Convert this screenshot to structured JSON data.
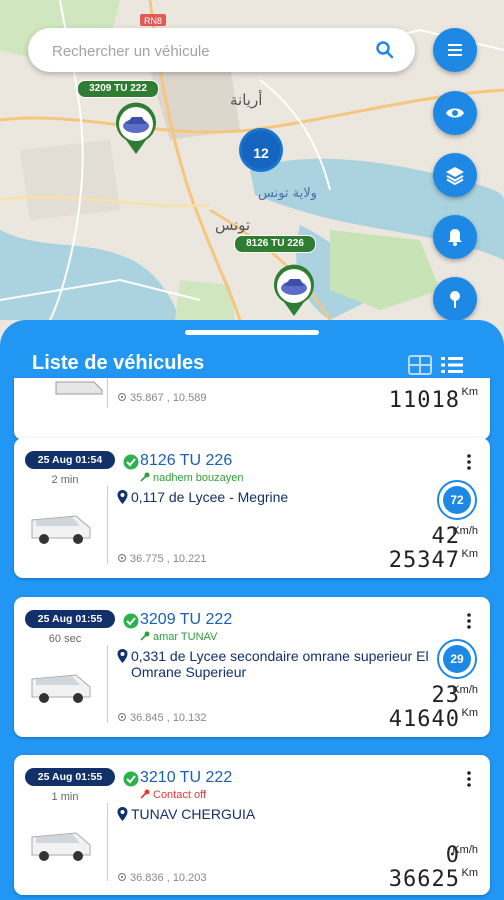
{
  "search": {
    "placeholder": "Rechercher un véhicule"
  },
  "map": {
    "labels": {
      "ariana": "أريانة",
      "tunis": "تونس",
      "wilayat": "ولاية تونس",
      "cluster_count": "12",
      "road": "RN8"
    },
    "markers": [
      {
        "plate": "3209 TU 222"
      },
      {
        "plate": "8126 TU 226"
      }
    ]
  },
  "fabs": [
    "menu-icon",
    "eye-icon",
    "layers-icon",
    "bell-icon",
    "pin-icon"
  ],
  "panel": {
    "title": "Liste de véhicules"
  },
  "vehicles_partial": {
    "coords": "35.867 , 10.589",
    "odometer": "11018",
    "odometer_unit": "Km"
  },
  "vehicles": [
    {
      "date": "25 Aug 01:54",
      "ago": "2 min",
      "plate": "8126 TU 226",
      "driver": "nadhem bouzayen",
      "location": "0,117 de Lycee - Megrine",
      "coords": "36.775 , 10.221",
      "speed_limit": "72",
      "speed": "42",
      "speed_unit": "Km/h",
      "odometer": "25347",
      "odometer_unit": "Km"
    },
    {
      "date": "25 Aug 01:55",
      "ago": "60 sec",
      "plate": "3209 TU 222",
      "driver": "amar TUNAV",
      "location": "0,331 de Lycee secondaire omrane superieur El Omrane Superieur",
      "coords": "36.845 , 10.132",
      "speed_limit": "29",
      "speed": "23",
      "speed_unit": "Km/h",
      "odometer": "41640",
      "odometer_unit": "Km"
    },
    {
      "date": "25 Aug 01:55",
      "ago": "1 min",
      "plate": "3210 TU 222",
      "driver": "Contact off",
      "location": "TUNAV CHERGUIA",
      "coords": "36.836 , 10.203",
      "speed": "0",
      "speed_unit": "Km/h",
      "odometer": "36625",
      "odometer_unit": "Km"
    }
  ],
  "colors": {
    "primary": "#2196f3",
    "fab": "#1e88e5",
    "badge": "#12306a",
    "ok_green": "#2bb24c",
    "driver_green": "#2e9d3c",
    "contact_off_red": "#e53935",
    "plate_blue": "#1a5fb4"
  }
}
